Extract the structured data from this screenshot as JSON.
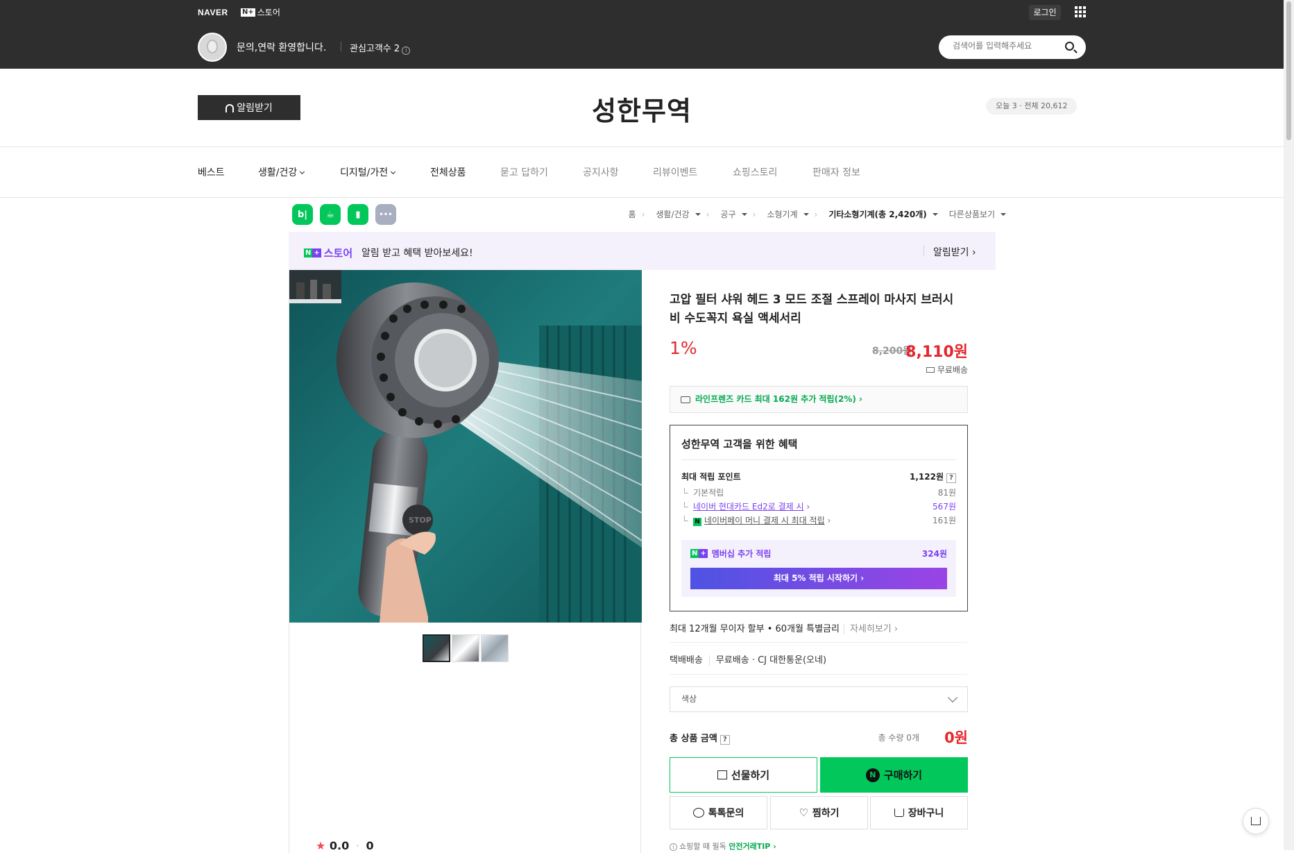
{
  "topbar": {
    "brand": "NAVER",
    "nplus_label": "스토어",
    "login": "로그인",
    "greeting": "문의,연락 환영합니다.",
    "interest": "관심고객수 2",
    "search_placeholder": "검색어를 입력해주세요"
  },
  "store": {
    "alarm_button": "알림받기",
    "title": "성한무역",
    "visitors": "오늘 3 · 전체 20,612"
  },
  "nav": {
    "items": [
      {
        "label": "베스트"
      },
      {
        "label": "생활/건강"
      },
      {
        "label": "디지털/가전"
      },
      {
        "label": "전체상품"
      },
      {
        "label": "묻고 답하기"
      },
      {
        "label": "공지사항"
      },
      {
        "label": "리뷰이벤트"
      },
      {
        "label": "쇼핑스토리"
      },
      {
        "label": "판매자 정보"
      }
    ]
  },
  "share_icons": [
    {
      "name": "blog-share-icon",
      "glyph": "b|",
      "color": "#03c75a"
    },
    {
      "name": "cafe-share-icon",
      "glyph": "☕",
      "color": "#03c75a"
    },
    {
      "name": "bookmark-share-icon",
      "glyph": "🔖",
      "color": "#03c75a"
    },
    {
      "name": "more-share-icon",
      "glyph": "•••",
      "color": "#a7afc0"
    }
  ],
  "breadcrumb": [
    "홈",
    "생활/건강",
    "공구",
    "소형기계",
    "기타소형기계(총 2,420개)",
    "다른상품보기"
  ],
  "banner": {
    "logo_text": "스토어",
    "message": "알림 받고 혜택 받아보세요!",
    "action": "알림받기"
  },
  "product": {
    "title": "고압 필터 샤워 헤드 3 모드 조절 스프레이 마사지 브러시 비 수도꼭지 욕실 액세서리",
    "discount": "1%",
    "original_price": "8,200원",
    "price": "8,110원",
    "shipping": "무료배송",
    "card_benefit": "라인프렌즈 카드 최대 162원 추가 적립(2%)",
    "image_stop_label": "STOP",
    "rating": "0.0",
    "review_count": "0"
  },
  "benefit": {
    "title": "성한무역 고객을 위한 혜택",
    "max_point_label": "최대 적립 포인트",
    "max_point_value": "1,122원",
    "rows": [
      {
        "label": "기본적립",
        "value": "81원"
      },
      {
        "label": "네이버 현대카드 Ed2로 결제 시",
        "value": "567원"
      },
      {
        "label": "네이버페이 머니 결제 시 최대 적립",
        "value": "161원"
      }
    ],
    "member_label": "멤버십 추가 적립",
    "member_value": "324원",
    "member_cta": "최대 5% 적립 시작하기"
  },
  "installment": {
    "text": "최대 12개월 무이자 할부 • 60개월 특별금리",
    "more": "자세히보기"
  },
  "delivery": {
    "type": "택배배송",
    "detail": "무료배송 · CJ 대한통운(오네)"
  },
  "option": {
    "placeholder": "색상"
  },
  "total": {
    "label": "총 상품 금액",
    "qty": "총 수량 0개",
    "amount": "0원"
  },
  "buttons": {
    "gift": "선물하기",
    "buy": "구매하기",
    "talk": "톡톡문의",
    "wish": "찜하기",
    "cart": "장바구니"
  },
  "tip": {
    "prefix": "쇼핑할 때 필독",
    "link": "안전거래TIP"
  },
  "colors": {
    "naver_green": "#02c75a",
    "sale_red": "#e4262c",
    "membership_purple": "#7a40f2",
    "topbar": "#2e2e2e"
  }
}
